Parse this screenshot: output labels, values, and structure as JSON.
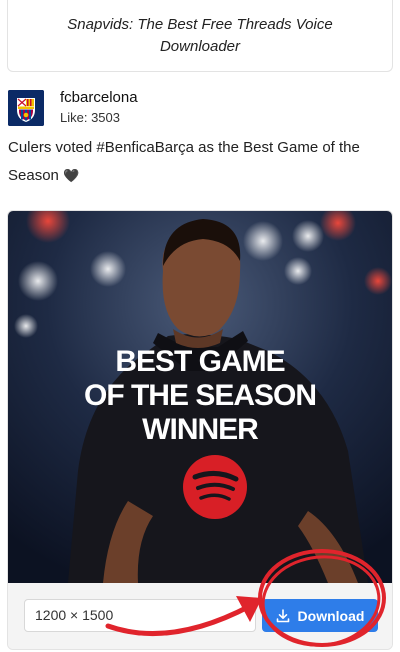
{
  "banner": {
    "text": "Snapvids: The Best Free Threads Voice Downloader"
  },
  "account": {
    "name": "fcbarcelona",
    "likes": "Like: 3503"
  },
  "post": {
    "caption": "Culers voted #BenficaBarça as the Best Game of the Season",
    "emoji": "🖤"
  },
  "media": {
    "overlay_lines": [
      "BEST GAME",
      "OF THE SEASON",
      "WINNER"
    ],
    "resolution": "1200 × 1500"
  },
  "actions": {
    "download_label": "Download",
    "download_icon": "download-icon"
  },
  "colors": {
    "accent": "#2e7de9",
    "annotation": "#e0242c",
    "spotify_red": "#d81f26"
  }
}
